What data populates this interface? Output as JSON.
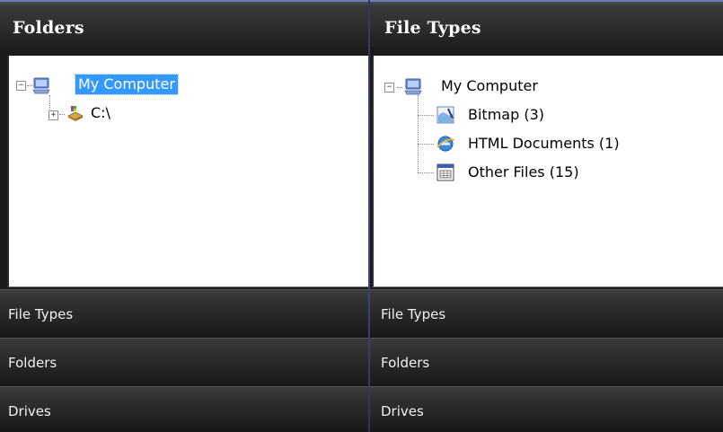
{
  "left_pane": {
    "title": "Folders",
    "tree": {
      "root_label": "My Computer",
      "root_expander": "−",
      "child_label": "C:\\",
      "child_expander": "+"
    },
    "groups": [
      "File Types",
      "Folders",
      "Drives"
    ]
  },
  "right_pane": {
    "title": "File Types",
    "tree": {
      "root_label": "My Computer",
      "root_expander": "−",
      "children": [
        {
          "label": "Bitmap (3)",
          "icon": "bitmap-icon"
        },
        {
          "label": "HTML Documents (1)",
          "icon": "html-document-icon"
        },
        {
          "label": "Other Files (15)",
          "icon": "other-files-icon"
        }
      ]
    },
    "groups": [
      "File Types",
      "Folders",
      "Drives"
    ]
  },
  "colors": {
    "selection": "#3399ff",
    "header_accent": "#6a7fb8",
    "divider": "#3b4f8c"
  }
}
